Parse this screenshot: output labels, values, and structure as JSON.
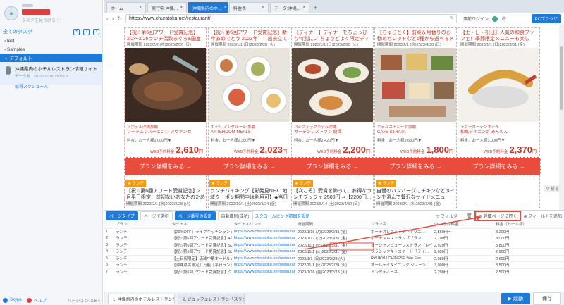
{
  "sidebar": {
    "search_hint": "タスクを見つける ⓘ",
    "all_tasks": "全てのタスク",
    "tree": [
      {
        "label": "test",
        "selected": false
      },
      {
        "label": "Samples",
        "selected": false
      },
      {
        "label": "デフォルト",
        "selected": true
      }
    ],
    "task": {
      "title": "沖縄県内のホテルレストラン情報サイト",
      "id_label": "データ数",
      "date": "2023-02-16 19:53:0",
      "link": "取得スケジュール"
    },
    "footer": {
      "skype": "Skype",
      "help": "ヘルプ",
      "version": "バージョン: 3.6.4"
    }
  },
  "tabs": [
    {
      "label": "ホーム",
      "active": false
    },
    {
      "label": "実行中:沖縄…",
      "active": false
    },
    {
      "label": "沖縄県内のホ…",
      "active": true
    },
    {
      "label": "料金表",
      "active": false
    },
    {
      "label": "データ:沖縄…",
      "active": false
    }
  ],
  "address": {
    "url": "https://www.churatoku.net/restaurant/",
    "login": "事前ログイン",
    "browser_btn": "PCブラウザ"
  },
  "cards": [
    {
      "title": "【祝☆第6回アワード受賞記念】2/2～2/26ランチ偶数まぐろ&国産和牛食…",
      "date": "開催期間 2023/2/2 (木)2023/2/26 (日)",
      "loc": "ノボテル沖縄那覇",
      "name": "フードエクスチェンジ アヴァンセ",
      "price_row": "料金：お一人様2,000円▼",
      "price": "2,610",
      "img": "steak"
    },
    {
      "title": "【祝☆第6回アワード受賞記念】新年あめでとう 2023年！！出来立てバス…",
      "date": "開催期間 2023/1/1 (日)2023/2/28 (火)",
      "loc": "ホテル アンダルーシ 那覇",
      "name": "ANTEROOM MEALS",
      "price_row": "料金：お一人様2,380円▼",
      "price": "2,023",
      "img": "buffet1"
    },
    {
      "title": "【ディナー】ディナーをちょっぴり特別にノ ちょうどよく限定ディナーで沖…",
      "date": "開催期間 2023/1/1 (日)2023/2/28 (火)",
      "loc": "パシフィックホテル沖縄",
      "name": "ガーデンレストラン 龍潭",
      "price_row": "料金：お一人様2,420円▼",
      "price": "2,200",
      "img": "buffet2"
    },
    {
      "title": "【ちゅらとく】前菜＆月替りのお勧めガレットなど6種から選べるメイン料…",
      "date": "開催期間 2023/2/1 (水)2023/4/30 (日)",
      "loc": "ホテルストレータ那覇",
      "name": "CAFE STRATA",
      "price_row": "料金：お一人様2,680円▼",
      "price": "1,800",
      "img": "buffet3"
    },
    {
      "title": "【土・日・祝日】人気の和食ブッフェ！季節限定メニューも楽しみ…",
      "date": "開催期間 2023/1/1 (日)2023/3/31 (金)",
      "loc": "ラグナガーデンホテル",
      "name": "和風ダイニング あんのん",
      "price_row": "料金：お一人様3,000円▼",
      "price": "2,370",
      "img": "tempura"
    }
  ],
  "price_label": "WEB予約料金",
  "yen": "円",
  "plan_label": "プラン詳細をみる →",
  "lower_cards": [
    {
      "tag": "★ ランチ",
      "title": "【祝☆第6回アワード受賞記念】2月平日限定：前初ないあなたのための…",
      "date": "開催期間 2023/2/1 (水)2023/2/28 (火)"
    },
    {
      "tag": "★ ランチ",
      "title": "ランチバイキング【彩発見NEXT地域クーポン期間中は利用可】◆当日13…",
      "date": "開催期間 2022/10/1 (土)2023/3/24 (金)"
    },
    {
      "tag": "★ ランチ",
      "title": "【次こそ】受賞を飾って、お得なランチブッフェ 2500円 ⇒【2200円…",
      "date": "開催期間 2023/5/14 (土)2023/4/30 (日)"
    },
    {
      "tag": "★ ランチ",
      "title": "自慢のハンバーグにチキンなどメインを選んで贅沢なサイドメニューは…",
      "date": "開催期間 2023/2/1 (水)2023/3/31 (金)"
    }
  ],
  "fold_label": "▽ 折る",
  "datatable": {
    "type_chip": "ページタイプ",
    "type_value": "ページで選択",
    "list_chip": "ページ番号の設定",
    "auto_chip": "自動識別(成功)",
    "scroll_link": "スクロールビング範囲を設定",
    "filter": "▽ フィルター",
    "detail_btn": "◎ 詳細ページに行く",
    "add_field": "⊕ フィールドを追加",
    "columns": [
      "",
      "プラン",
      "タイトル",
      "タイトルリンク",
      "開催期間",
      "プラン名",
      "WEB予約料金",
      "料金（お一人様）"
    ],
    "rows": [
      [
        "1",
        "ランチ",
        "【20%OFF】ライブキッチンランチ…",
        "https://www.churatoku.net/restaurant…",
        "2023/1/16 (月)2023/3/31 (金)",
        "ボーナスレストラン「オリエ…",
        "2,560円～",
        "3,200円"
      ],
      [
        "2",
        "ランチ",
        "【祝☆第6回アワード受賞記念】4平日…",
        "https://www.churatoku.net/restaurant…",
        "2023/1/17 (火)2023/3/31 (金)",
        "ボーナスレストラン「ブラン…",
        "2,700円",
        "3,000円"
      ],
      [
        "3",
        "ランチ",
        "【祝☆第6回アワード受賞記念】SUI…",
        "https://www.churatoku.net/restaurant…",
        "2022/11/1 (火)2023/3/31 (金)",
        "オーシャンビューレストラン「レイ…",
        "2,920円",
        "3,800円"
      ],
      [
        "4",
        "ランチ",
        "【祝☆第6回アワード受賞記念】SUI…",
        "https://www.churatoku.net/restaurant…",
        "2022/11/1 (火)2023/3/31 (金)",
        "クラシックキャスケード「ライ…",
        "2,650円",
        "2,900円"
      ],
      [
        "5",
        "ランチ",
        "【土日祝限定】琉球中華オードルビュ…",
        "https://www.churatoku.net/restaurant…",
        "2023/1/1 (日)2023/2/28 (火)",
        "RYUKYU CHINESE Bon Fire",
        "2,080円",
        "2,600円"
      ],
      [
        "6",
        "ランチ",
        "【沖縄県民限定】万能【平日ランチ…",
        "https://www.churatoku.net/restaurant…",
        "2022/11/1 (火)2023/2/28 (火)",
        "オールデイダイニング ジノーン",
        "3,000円",
        "3,500円"
      ],
      [
        "7",
        "ランチ",
        "【祝☆第6回アワード受賞記念】クリ…",
        "https://www.churatoku.net/restaurant…",
        "2023/1/16 (金)2023/2/28 (火)",
        "ドンタディーネ",
        "2,290円",
        "2,500円"
      ]
    ]
  },
  "bottom": {
    "tab1": "1. 沖縄県内のホテルレストラン情…",
    "tab2": "2. ピュッフェレストラン「スリゴ…",
    "run": "▶ 起動",
    "save": "保存"
  }
}
